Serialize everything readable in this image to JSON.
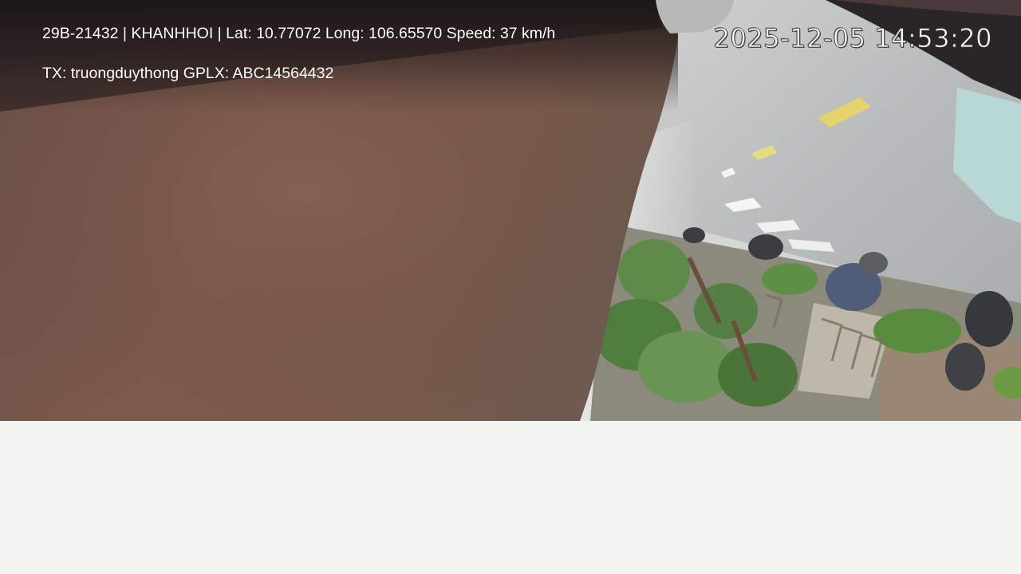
{
  "overlay": {
    "vehicle_info": "29B-21432 | KHANHHOI | Lat: 10.77072 Long: 106.65570 Speed: 37 km/h",
    "driver_info": "TX: truongduythong GPLX: ABC14564432",
    "timestamp": "2025-12-05 14:53:20"
  },
  "colors": {
    "interior_wall": "#7a5a4e",
    "road": "#b9bcbc",
    "foliage": "#5e8a4a",
    "lane_marking_yellow": "#e3d36a",
    "background": "#f4f5f3"
  }
}
